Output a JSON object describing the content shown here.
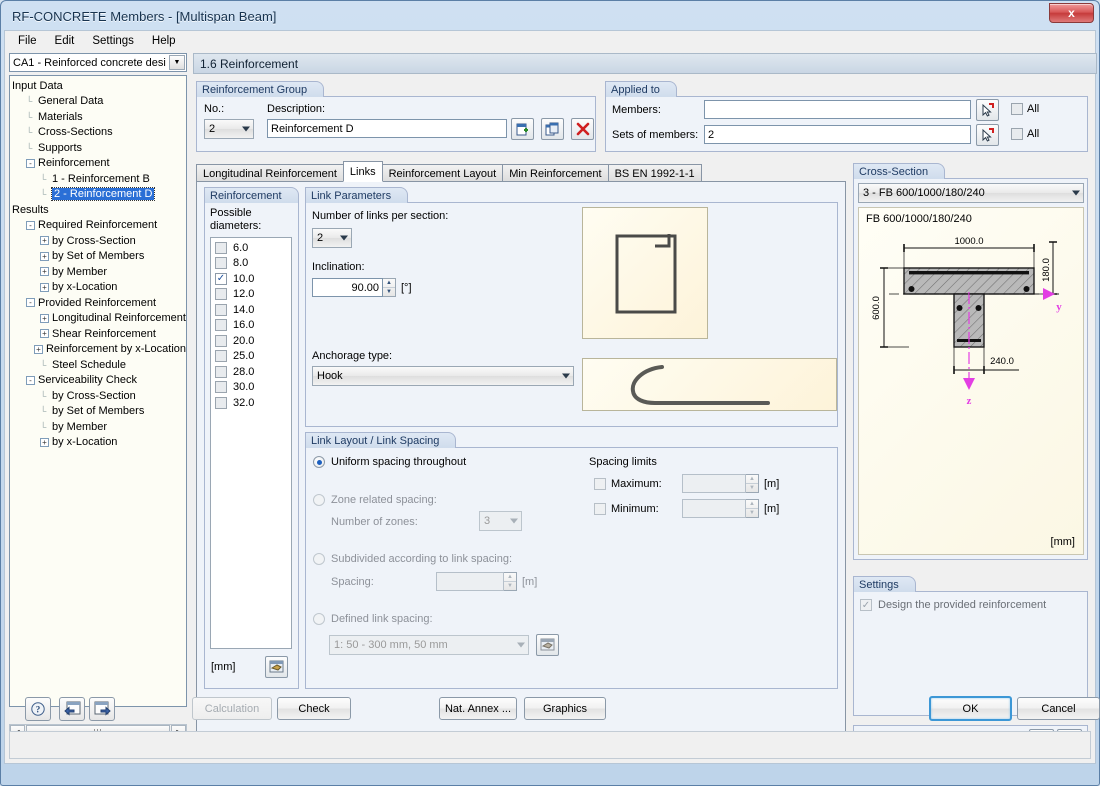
{
  "window": {
    "title": "RF-CONCRETE Members - [Multispan Beam]",
    "close_label": "x"
  },
  "menu": {
    "items": [
      "File",
      "Edit",
      "Settings",
      "Help"
    ]
  },
  "sidebar": {
    "combo_value": "CA1 - Reinforced concrete desi",
    "tree": [
      {
        "label": "Input Data",
        "level": 0,
        "toggle": "",
        "selected": false
      },
      {
        "label": "General Data",
        "level": 1,
        "toggle": "",
        "selected": false
      },
      {
        "label": "Materials",
        "level": 1,
        "toggle": "",
        "selected": false
      },
      {
        "label": "Cross-Sections",
        "level": 1,
        "toggle": "",
        "selected": false
      },
      {
        "label": "Supports",
        "level": 1,
        "toggle": "",
        "selected": false
      },
      {
        "label": "Reinforcement",
        "level": 1,
        "toggle": "-",
        "selected": false
      },
      {
        "label": "1 - Reinforcement B",
        "level": 2,
        "toggle": "",
        "selected": false
      },
      {
        "label": "2 - Reinforcement D",
        "level": 2,
        "toggle": "",
        "selected": true
      },
      {
        "label": "Results",
        "level": 0,
        "toggle": "",
        "selected": false
      },
      {
        "label": "Required Reinforcement",
        "level": 1,
        "toggle": "-",
        "selected": false
      },
      {
        "label": "by Cross-Section",
        "level": 2,
        "toggle": "+",
        "selected": false
      },
      {
        "label": "by Set of Members",
        "level": 2,
        "toggle": "+",
        "selected": false
      },
      {
        "label": "by Member",
        "level": 2,
        "toggle": "+",
        "selected": false
      },
      {
        "label": "by x-Location",
        "level": 2,
        "toggle": "+",
        "selected": false
      },
      {
        "label": "Provided Reinforcement",
        "level": 1,
        "toggle": "-",
        "selected": false
      },
      {
        "label": "Longitudinal Reinforcement",
        "level": 2,
        "toggle": "+",
        "selected": false
      },
      {
        "label": "Shear Reinforcement",
        "level": 2,
        "toggle": "+",
        "selected": false
      },
      {
        "label": "Reinforcement by x-Location",
        "level": 2,
        "toggle": "+",
        "selected": false
      },
      {
        "label": "Steel Schedule",
        "level": 2,
        "toggle": "",
        "selected": false
      },
      {
        "label": "Serviceability Check",
        "level": 1,
        "toggle": "-",
        "selected": false
      },
      {
        "label": "by Cross-Section",
        "level": 2,
        "toggle": "",
        "selected": false
      },
      {
        "label": "by Set of Members",
        "level": 2,
        "toggle": "",
        "selected": false
      },
      {
        "label": "by Member",
        "level": 2,
        "toggle": "",
        "selected": false
      },
      {
        "label": "by x-Location",
        "level": 2,
        "toggle": "+",
        "selected": false
      }
    ]
  },
  "page": {
    "heading": "1.6 Reinforcement"
  },
  "reinforcement_group": {
    "caption": "Reinforcement Group",
    "no_label": "No.:",
    "no_value": "2",
    "description_label": "Description:",
    "description_value": "Reinforcement D",
    "new_icon": "new-page-icon",
    "copy_icon": "copy-icon",
    "delete_icon": "delete-x-icon"
  },
  "applied_to": {
    "caption": "Applied to",
    "members_label": "Members:",
    "members_value": "",
    "sets_label": "Sets of members:",
    "sets_value": "2",
    "all_label_1": "All",
    "all_label_2": "All",
    "pick_icon": "pick-pointer-icon"
  },
  "tabs": [
    {
      "label": "Longitudinal Reinforcement",
      "active": false
    },
    {
      "label": "Links",
      "active": true
    },
    {
      "label": "Reinforcement Layout",
      "active": false
    },
    {
      "label": "Min Reinforcement",
      "active": false
    },
    {
      "label": "BS EN 1992-1-1",
      "active": false
    }
  ],
  "reinforcement_panel": {
    "caption": "Reinforcement",
    "possible_label": "Possible diameters:",
    "unit": "[mm]",
    "edit_icon": "edit-table-icon",
    "diameters": [
      {
        "value": "6.0",
        "checked": false
      },
      {
        "value": "8.0",
        "checked": false
      },
      {
        "value": "10.0",
        "checked": true
      },
      {
        "value": "12.0",
        "checked": false
      },
      {
        "value": "14.0",
        "checked": false
      },
      {
        "value": "16.0",
        "checked": false
      },
      {
        "value": "20.0",
        "checked": false
      },
      {
        "value": "25.0",
        "checked": false
      },
      {
        "value": "28.0",
        "checked": false
      },
      {
        "value": "30.0",
        "checked": false
      },
      {
        "value": "32.0",
        "checked": false
      }
    ]
  },
  "link_parameters": {
    "caption": "Link Parameters",
    "number_label": "Number of links per section:",
    "number_value": "2",
    "inclination_label": "Inclination:",
    "inclination_value": "90.00",
    "inclination_unit": "[°]",
    "anchorage_label": "Anchorage type:",
    "anchorage_value": "Hook",
    "stirrup_preview_icon": "stirrup-shape-icon",
    "hook_preview_icon": "hook-shape-icon"
  },
  "link_layout": {
    "caption": "Link Layout / Link Spacing",
    "uniform_label": "Uniform spacing throughout",
    "uniform_selected": true,
    "zone_label": "Zone related spacing:",
    "zone_selected": false,
    "zones_label": "Number of zones:",
    "zones_value": "3",
    "subdivided_label": "Subdivided according to link spacing:",
    "subdivided_selected": false,
    "spacing_label": "Spacing:",
    "spacing_value": "",
    "spacing_unit": "[m]",
    "defined_label": "Defined link spacing:",
    "defined_selected": false,
    "defined_value": "1: 50 - 300 mm, 50 mm",
    "defined_edit_icon": "edit-list-icon",
    "limits_title": "Spacing limits",
    "max_label": "Maximum:",
    "max_checked": false,
    "max_value": "",
    "max_unit": "[m]",
    "min_label": "Minimum:",
    "min_checked": false,
    "min_value": "",
    "min_unit": "[m]"
  },
  "cross_section": {
    "caption": "Cross-Section",
    "combo_value": "3 - FB 600/1000/180/240",
    "name": "FB 600/1000/180/240",
    "unit": "[mm]",
    "dimensions": {
      "top_width": "1000.0",
      "flange_depth": "180.0",
      "total_depth": "600.0",
      "web_width": "240.0"
    },
    "axis_y": "y",
    "axis_z": "z"
  },
  "settings": {
    "caption": "Settings",
    "design_label": "Design the provided reinforcement",
    "design_checked": true,
    "tool_icon_1": "section-info-icon",
    "tool_icon_2": "section-info-icon-2"
  },
  "footer": {
    "help_icon": "help-question-icon",
    "prev_icon": "previous-arrow-icon",
    "next_icon": "next-arrow-icon",
    "calculation_label": "Calculation",
    "check_label": "Check",
    "nat_annex_label": "Nat. Annex ...",
    "graphics_label": "Graphics",
    "ok_label": "OK",
    "cancel_label": "Cancel"
  }
}
